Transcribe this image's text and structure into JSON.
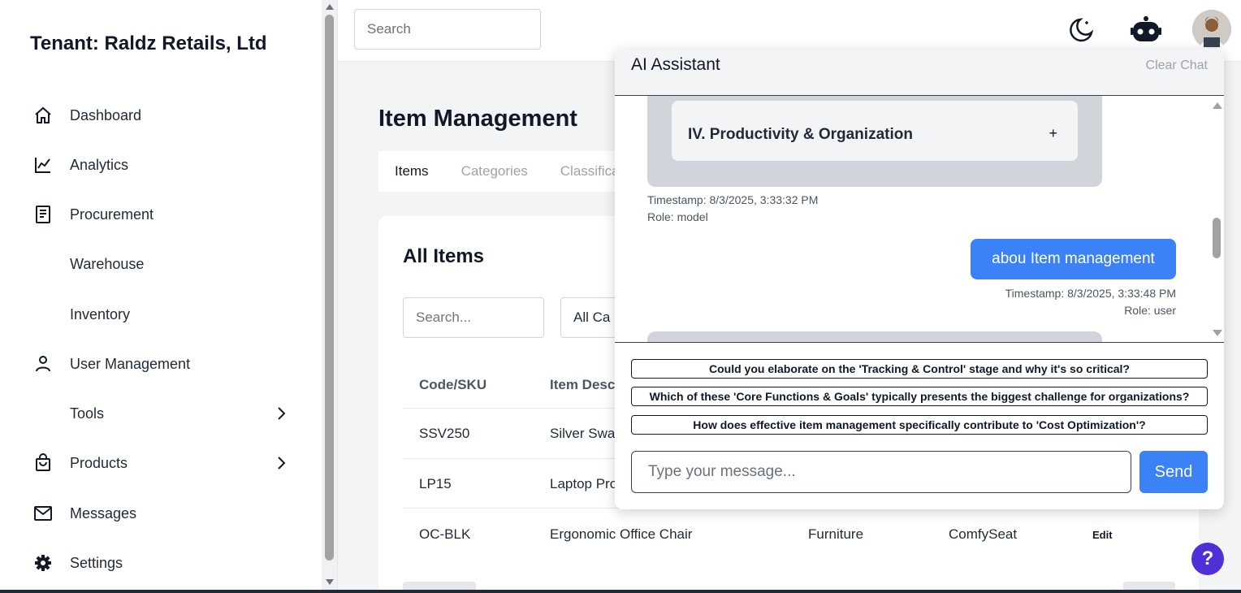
{
  "sidebar": {
    "tenant": "Tenant: Raldz Retails, Ltd",
    "items": [
      {
        "label": "Dashboard",
        "icon": "home-icon"
      },
      {
        "label": "Analytics",
        "icon": "chart-line-icon"
      },
      {
        "label": "Procurement",
        "icon": "document-icon"
      },
      {
        "label": "Warehouse",
        "icon": ""
      },
      {
        "label": "Inventory",
        "icon": ""
      },
      {
        "label": "User Management",
        "icon": "user-icon"
      },
      {
        "label": "Tools",
        "icon": "",
        "chevron": true
      },
      {
        "label": "Products",
        "icon": "shopping-bag-icon",
        "chevron": true
      },
      {
        "label": "Messages",
        "icon": "mail-icon"
      },
      {
        "label": "Settings",
        "icon": "gear-icon"
      }
    ]
  },
  "topbar": {
    "search_placeholder": "Search",
    "icons": [
      "moon-icon",
      "robot-icon",
      "avatar"
    ]
  },
  "main": {
    "title": "Item Management",
    "tabs": [
      "Items",
      "Categories",
      "Classifica"
    ],
    "card": {
      "title": "All Items",
      "search_placeholder": "Search...",
      "filter_label": "All Ca",
      "columns": [
        "Code/SKU",
        "Item Desc"
      ],
      "rows": [
        {
          "code": "SSV250",
          "desc": "Silver Swar",
          "category": "",
          "brand": "",
          "action": ""
        },
        {
          "code": "LP15",
          "desc": "Laptop Pro",
          "category": "",
          "brand": "",
          "action": ""
        },
        {
          "code": "OC-BLK",
          "desc": "Ergonomic Office Chair",
          "category": "Furniture",
          "brand": "ComfySeat",
          "action": "Edit"
        }
      ]
    }
  },
  "ai": {
    "title": "AI Assistant",
    "clear_label": "Clear Chat",
    "accordion_title": "IV. Productivity & Organization",
    "accordion_toggle": "+",
    "model_timestamp": "Timestamp: 8/3/2025, 3:33:32 PM",
    "model_role": "Role: model",
    "user_message": "abou Item management",
    "user_timestamp": "Timestamp: 8/3/2025, 3:33:48 PM",
    "user_role": "Role: user",
    "suggestions": [
      "Could you elaborate on the 'Tracking & Control' stage and why it's so critical?",
      "Which of these 'Core Functions & Goals' typically presents the biggest challenge for organizations?",
      "How does effective item management specifically contribute to 'Cost Optimization'?"
    ],
    "input_placeholder": "Type your message...",
    "send_label": "Send"
  },
  "help_label": "?",
  "colors": {
    "accent": "#3b82f6",
    "help": "#4f2fd6",
    "bubble_model": "#d1d5db"
  }
}
